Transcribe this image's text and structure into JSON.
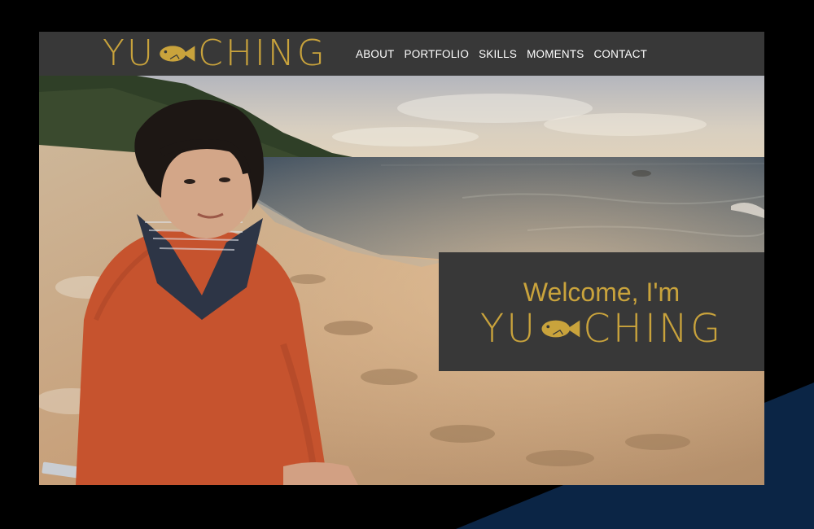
{
  "brand": {
    "logo_left": "YU",
    "logo_right": "CHING",
    "gold_color": "#c9a33c"
  },
  "nav": {
    "items": [
      {
        "label": "ABOUT"
      },
      {
        "label": "PORTFOLIO"
      },
      {
        "label": "SKILLS"
      },
      {
        "label": "MOMENTS"
      },
      {
        "label": "CONTACT"
      }
    ]
  },
  "hero": {
    "welcome": "Welcome, I'm",
    "logo_left": "YU",
    "logo_right": "CHING",
    "photo_icon": "portrait-on-beach-photo"
  },
  "colors": {
    "background": "#000000",
    "navbar": "#383838",
    "welcome_box": "#383838",
    "accent_navy": "#0b2545"
  }
}
